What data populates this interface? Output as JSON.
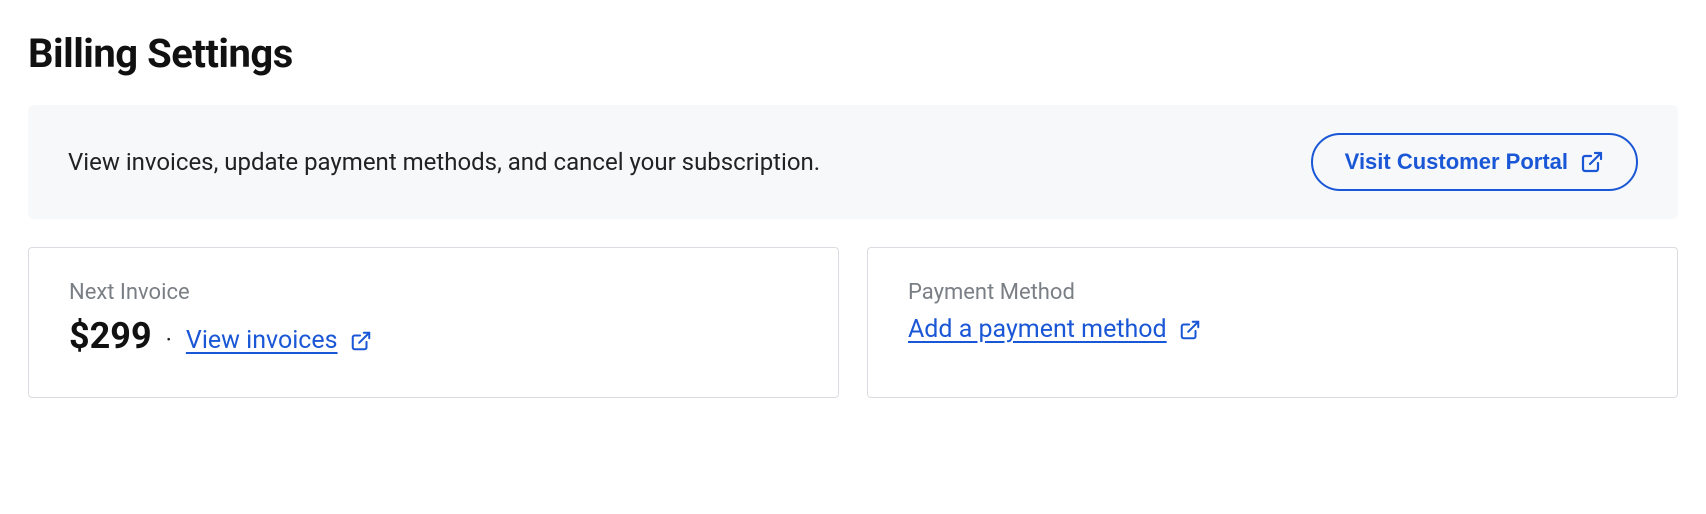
{
  "page": {
    "title": "Billing Settings"
  },
  "banner": {
    "description": "View invoices, update payment methods, and cancel your subscription.",
    "portal_button_label": "Visit Customer Portal"
  },
  "cards": {
    "next_invoice": {
      "label": "Next Invoice",
      "amount": "$299",
      "separator": "·",
      "link_label": "View invoices"
    },
    "payment_method": {
      "label": "Payment Method",
      "link_label": "Add a payment method"
    }
  },
  "colors": {
    "primary": "#1a57d6",
    "banner_bg": "#f6f8fa",
    "card_border": "#d9dde1",
    "text_muted": "#7a7f85"
  }
}
